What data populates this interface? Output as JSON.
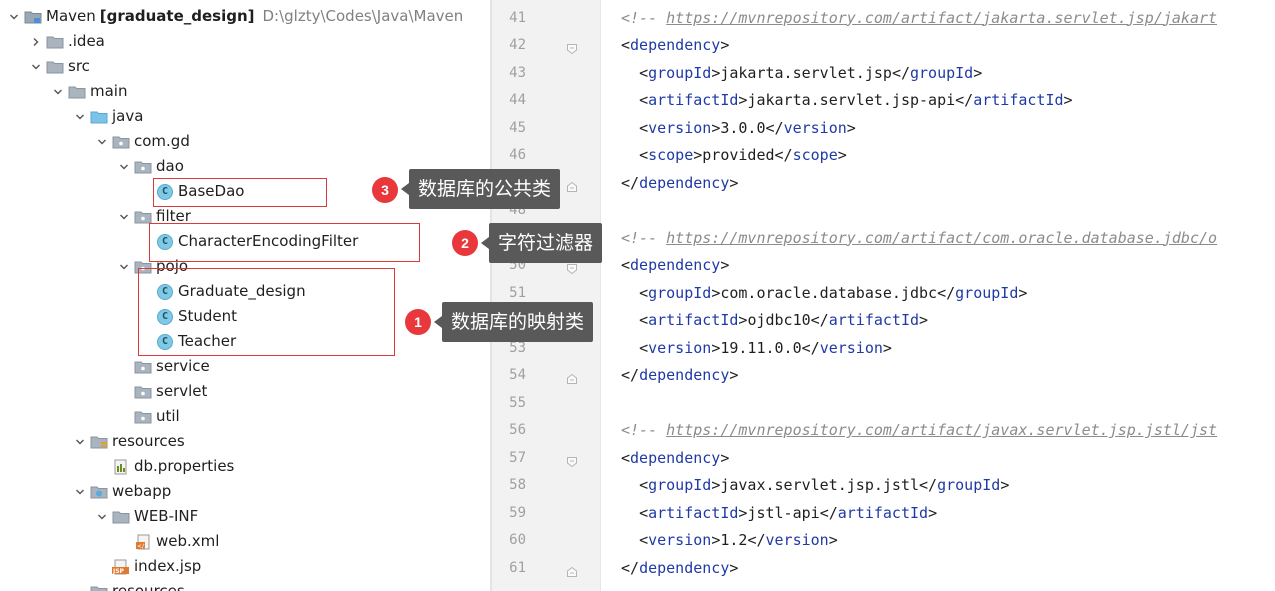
{
  "project": {
    "name": "Maven",
    "module": "[graduate_design]",
    "path": "D:\\glzty\\Codes\\Java\\Maven"
  },
  "tree": [
    {
      "label": "Maven",
      "depth": 0,
      "chev": "down",
      "icon": "module-folder-icon"
    },
    {
      "label": ".idea",
      "depth": 1,
      "chev": "right",
      "icon": "folder-icon"
    },
    {
      "label": "src",
      "depth": 1,
      "chev": "down",
      "icon": "folder-icon"
    },
    {
      "label": "main",
      "depth": 2,
      "chev": "down",
      "icon": "folder-icon"
    },
    {
      "label": "java",
      "depth": 3,
      "chev": "down",
      "icon": "source-folder-icon"
    },
    {
      "label": "com.gd",
      "depth": 4,
      "chev": "down",
      "icon": "package-icon"
    },
    {
      "label": "dao",
      "depth": 5,
      "chev": "down",
      "icon": "package-icon"
    },
    {
      "label": "BaseDao",
      "depth": 6,
      "chev": "none",
      "icon": "class-icon"
    },
    {
      "label": "filter",
      "depth": 5,
      "chev": "down",
      "icon": "package-icon"
    },
    {
      "label": "CharacterEncodingFilter",
      "depth": 6,
      "chev": "none",
      "icon": "class-icon"
    },
    {
      "label": "pojo",
      "depth": 5,
      "chev": "down",
      "icon": "package-icon"
    },
    {
      "label": "Graduate_design",
      "depth": 6,
      "chev": "none",
      "icon": "class-icon"
    },
    {
      "label": "Student",
      "depth": 6,
      "chev": "none",
      "icon": "class-icon"
    },
    {
      "label": "Teacher",
      "depth": 6,
      "chev": "none",
      "icon": "class-icon"
    },
    {
      "label": "service",
      "depth": 5,
      "chev": "none",
      "icon": "package-icon"
    },
    {
      "label": "servlet",
      "depth": 5,
      "chev": "none",
      "icon": "package-icon"
    },
    {
      "label": "util",
      "depth": 5,
      "chev": "none",
      "icon": "package-icon"
    },
    {
      "label": "resources",
      "depth": 3,
      "chev": "down",
      "icon": "resources-folder-icon"
    },
    {
      "label": "db.properties",
      "depth": 4,
      "chev": "none",
      "icon": "properties-file-icon"
    },
    {
      "label": "webapp",
      "depth": 3,
      "chev": "down",
      "icon": "web-folder-icon"
    },
    {
      "label": "WEB-INF",
      "depth": 4,
      "chev": "down",
      "icon": "folder-icon"
    },
    {
      "label": "web.xml",
      "depth": 5,
      "chev": "none",
      "icon": "xml-file-icon"
    },
    {
      "label": "index.jsp",
      "depth": 4,
      "chev": "none",
      "icon": "jsp-file-icon"
    },
    {
      "label": "resources",
      "depth": 3,
      "chev": "none",
      "icon": "resources-folder-icon"
    }
  ],
  "editor": {
    "lines": [
      {
        "n": "41",
        "kind": "comment",
        "text": "https://mvnrepository.com/artifact/jakarta.servlet.jsp/jakart"
      },
      {
        "n": "42",
        "kind": "open",
        "indent": 0,
        "tag": "dependency"
      },
      {
        "n": "43",
        "kind": "elem",
        "indent": 1,
        "tag": "groupId",
        "value": "jakarta.servlet.jsp"
      },
      {
        "n": "44",
        "kind": "elem",
        "indent": 1,
        "tag": "artifactId",
        "value": "jakarta.servlet.jsp-api"
      },
      {
        "n": "45",
        "kind": "elem",
        "indent": 1,
        "tag": "version",
        "value": "3.0.0"
      },
      {
        "n": "46",
        "kind": "elem",
        "indent": 1,
        "tag": "scope",
        "value": "provided"
      },
      {
        "n": "47",
        "kind": "close",
        "indent": 0,
        "tag": "dependency"
      },
      {
        "n": "48",
        "kind": "blank"
      },
      {
        "n": "49",
        "kind": "comment",
        "text": "https://mvnrepository.com/artifact/com.oracle.database.jdbc/o"
      },
      {
        "n": "50",
        "kind": "open",
        "indent": 0,
        "tag": "dependency"
      },
      {
        "n": "51",
        "kind": "elem",
        "indent": 1,
        "tag": "groupId",
        "value": "com.oracle.database.jdbc"
      },
      {
        "n": "52",
        "kind": "elem",
        "indent": 1,
        "tag": "artifactId",
        "value": "ojdbc10"
      },
      {
        "n": "53",
        "kind": "elem",
        "indent": 1,
        "tag": "version",
        "value": "19.11.0.0"
      },
      {
        "n": "54",
        "kind": "close",
        "indent": 0,
        "tag": "dependency"
      },
      {
        "n": "55",
        "kind": "blank"
      },
      {
        "n": "56",
        "kind": "comment",
        "text": "https://mvnrepository.com/artifact/javax.servlet.jsp.jstl/jst"
      },
      {
        "n": "57",
        "kind": "open",
        "indent": 0,
        "tag": "dependency"
      },
      {
        "n": "58",
        "kind": "elem",
        "indent": 1,
        "tag": "groupId",
        "value": "javax.servlet.jsp.jstl"
      },
      {
        "n": "59",
        "kind": "elem",
        "indent": 1,
        "tag": "artifactId",
        "value": "jstl-api"
      },
      {
        "n": "60",
        "kind": "elem",
        "indent": 1,
        "tag": "version",
        "value": "1.2"
      },
      {
        "n": "61",
        "kind": "close",
        "indent": 0,
        "tag": "dependency"
      }
    ]
  },
  "annotations": [
    {
      "number": "3",
      "text": "数据库的公共类"
    },
    {
      "number": "2",
      "text": "字符过滤器"
    },
    {
      "number": "1",
      "text": "数据库的映射类"
    }
  ],
  "colors": {
    "tag": "#1f3aa6",
    "comment": "#8c8c8c",
    "badge": "#e8383b",
    "callout": "#595959",
    "box": "#d93a3a"
  }
}
